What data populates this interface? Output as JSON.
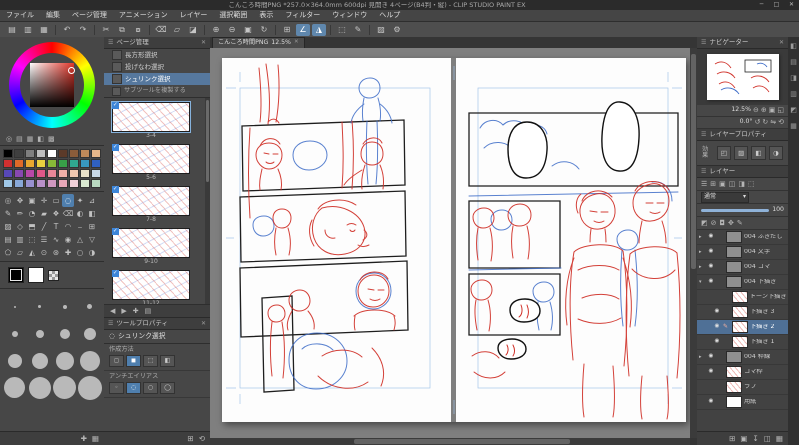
{
  "window": {
    "title": "こんころ時間PNG *257.0×364.0mm 600dpi 見開き 4ページ(B4判・縦) - CLIP STUDIO PAINT EX",
    "controls": {
      "min": "─",
      "max": "□",
      "close": "✕"
    }
  },
  "menubar": {
    "items": [
      "ファイル",
      "編集",
      "ページ管理",
      "アニメーション",
      "レイヤー",
      "選択範囲",
      "表示",
      "フィルター",
      "ウィンドウ",
      "ヘルプ"
    ]
  },
  "toolbar": {
    "icons": [
      {
        "name": "new-file-icon",
        "glyph": "▤"
      },
      {
        "name": "open-file-icon",
        "glyph": "▥"
      },
      {
        "name": "save-icon",
        "glyph": "▦"
      },
      {
        "sep": true
      },
      {
        "name": "undo-icon",
        "glyph": "↶"
      },
      {
        "name": "redo-icon",
        "glyph": "↷"
      },
      {
        "sep": true
      },
      {
        "name": "cut-icon",
        "glyph": "✂"
      },
      {
        "name": "copy-icon",
        "glyph": "⧉"
      },
      {
        "name": "paste-icon",
        "glyph": "⧇"
      },
      {
        "sep": true
      },
      {
        "name": "delete-icon",
        "glyph": "⌫"
      },
      {
        "name": "deselect-icon",
        "glyph": "▱"
      },
      {
        "name": "invert-selection-icon",
        "glyph": "◪"
      },
      {
        "sep": true
      },
      {
        "name": "zoom-in-icon",
        "glyph": "⊕"
      },
      {
        "name": "zoom-out-icon",
        "glyph": "⊖"
      },
      {
        "name": "fit-to-screen-icon",
        "glyph": "▣"
      },
      {
        "name": "rotate-view-icon",
        "glyph": "↻"
      },
      {
        "sep": true
      },
      {
        "name": "snap-grid-icon",
        "glyph": "⊞"
      },
      {
        "name": "snap-ruler-icon",
        "glyph": "∠",
        "active": true
      },
      {
        "name": "snap-special-ruler-icon",
        "glyph": "◮",
        "active": true
      },
      {
        "sep": true
      },
      {
        "name": "selection-tool-icon",
        "glyph": "⬚"
      },
      {
        "name": "pen-tool-icon",
        "glyph": "✎"
      },
      {
        "sep": true
      },
      {
        "name": "material-palette-icon",
        "glyph": "▨"
      },
      {
        "name": "settings-icon",
        "glyph": "⚙"
      }
    ]
  },
  "left_panel": {
    "color_icons": [
      {
        "name": "color-wheel-tab-icon",
        "glyph": "◎"
      },
      {
        "name": "color-slider-tab-icon",
        "glyph": "▤"
      },
      {
        "name": "color-set-tab-icon",
        "glyph": "▦"
      },
      {
        "name": "intermediate-color-tab-icon",
        "glyph": "◧"
      },
      {
        "name": "approximate-color-tab-icon",
        "glyph": "▩"
      }
    ],
    "swatches": [
      "#000000",
      "#3f3f3f",
      "#7f7f7f",
      "#bfbfbf",
      "#ffffff",
      "#5b3a29",
      "#8a5c3a",
      "#c08a5a",
      "#e8b88a",
      "#d03030",
      "#e06a28",
      "#e8a830",
      "#e8d040",
      "#88b838",
      "#38a048",
      "#30a890",
      "#3898c0",
      "#3060c0",
      "#5848b8",
      "#8848b0",
      "#b848a8",
      "#e05888",
      "#e88898",
      "#f0b0a8",
      "#f0c8b0",
      "#e8e0c8",
      "#c8d8e8",
      "#a0c8e8",
      "#88a8d8",
      "#9890d0",
      "#b890c8",
      "#d098c0",
      "#e8a8b8",
      "#f0d0d8",
      "#d8e8d0",
      "#b8d8c0"
    ],
    "tools": [
      {
        "name": "zoom-tool-icon",
        "glyph": "◎"
      },
      {
        "name": "move-tool-icon",
        "glyph": "✥"
      },
      {
        "name": "operation-tool-icon",
        "glyph": "▣"
      },
      {
        "name": "layer-move-tool-icon",
        "glyph": "✛"
      },
      {
        "name": "rect-select-tool-icon",
        "glyph": "▭"
      },
      {
        "name": "lasso-select-tool-icon",
        "glyph": "◌",
        "active": true
      },
      {
        "name": "auto-select-tool-icon",
        "glyph": "✦"
      },
      {
        "name": "eyedropper-tool-icon",
        "glyph": "⊿"
      },
      {
        "name": "pen-tool-icon",
        "glyph": "✎"
      },
      {
        "name": "pencil-tool-icon",
        "glyph": "✏"
      },
      {
        "name": "airbrush-tool-icon",
        "glyph": "◔"
      },
      {
        "name": "brush-tool-icon",
        "glyph": "▰"
      },
      {
        "name": "decoration-tool-icon",
        "glyph": "❖"
      },
      {
        "name": "eraser-tool-icon",
        "glyph": "⌫"
      },
      {
        "name": "blend-tool-icon",
        "glyph": "◐"
      },
      {
        "name": "fill-tool-icon",
        "glyph": "◧"
      },
      {
        "name": "gradient-tool-icon",
        "glyph": "▨"
      },
      {
        "name": "figure-tool-icon",
        "glyph": "◇"
      },
      {
        "name": "frame-border-tool-icon",
        "glyph": "⬒"
      },
      {
        "name": "ruler-tool-icon",
        "glyph": "╱"
      },
      {
        "name": "text-tool-icon",
        "glyph": "T"
      },
      {
        "name": "balloon-tool-icon",
        "glyph": "◠"
      },
      {
        "name": "line-tool-icon",
        "glyph": "⎯"
      },
      {
        "name": "grid-tool-icon",
        "glyph": "⊞"
      },
      {
        "name": "tone-a-tool-icon",
        "glyph": "▤"
      },
      {
        "name": "tone-b-tool-icon",
        "glyph": "▥"
      },
      {
        "name": "pattern-tool-icon",
        "glyph": "⬚"
      },
      {
        "name": "hatch-tool-icon",
        "glyph": "☰"
      },
      {
        "name": "wave-tool-icon",
        "glyph": "∿"
      },
      {
        "name": "curve-tool-icon",
        "glyph": "◉"
      },
      {
        "name": "triangle-tool-icon",
        "glyph": "△"
      },
      {
        "name": "inv-triangle-tool-icon",
        "glyph": "▽"
      },
      {
        "name": "polygon-tool-icon",
        "glyph": "⬠"
      },
      {
        "name": "parallelogram-tool-icon",
        "glyph": "▱"
      },
      {
        "name": "cone-tool-icon",
        "glyph": "◭"
      },
      {
        "name": "dot-tool-icon",
        "glyph": "⊙"
      },
      {
        "name": "spiral-tool-icon",
        "glyph": "⊛"
      },
      {
        "name": "plus-tool-icon",
        "glyph": "✚"
      },
      {
        "name": "circle-sel-tool-icon",
        "glyph": "○"
      },
      {
        "name": "mix-tool-icon",
        "glyph": "◑"
      }
    ],
    "current_colors": {
      "main": "#000000",
      "sub": "#ffffff"
    },
    "brush_sizes": [
      2,
      3,
      4,
      5,
      6,
      8,
      10,
      12,
      14,
      16,
      18,
      20,
      21,
      22,
      23,
      24
    ],
    "footer": {
      "add_icon": "✚",
      "delete_icon": "▦"
    }
  },
  "pages_panel": {
    "header": "ページ管理",
    "subtools": [
      {
        "label": "長方形選択"
      },
      {
        "label": "投げなわ選択"
      },
      {
        "label": "シュリンク選択",
        "selected": true
      }
    ],
    "option_label": "サブツールを複製する",
    "pages": [
      {
        "label": "3-4",
        "badge": "✓",
        "selected": true
      },
      {
        "label": "5-6",
        "badge": "✓"
      },
      {
        "label": "7-8",
        "badge": "✓"
      },
      {
        "label": "9-10",
        "badge": "✓"
      },
      {
        "label": "11-12",
        "badge": "✓"
      }
    ],
    "footer_icons": [
      {
        "name": "prev-page-icon",
        "glyph": "◀"
      },
      {
        "name": "next-page-icon",
        "glyph": "▶"
      },
      {
        "name": "add-page-icon",
        "glyph": "✚"
      },
      {
        "name": "page-list-icon",
        "glyph": "▤"
      }
    ]
  },
  "tool_property": {
    "header": "ツールプロパティ",
    "subtitle": "シュリンク選択",
    "props": [
      {
        "label": "作成方法",
        "icons": [
          "◻",
          "◼",
          "⬚",
          "◧"
        ],
        "active_index": 1
      },
      {
        "label": "アンチエイリアス",
        "icons": [
          "◦",
          "◌",
          "○",
          "◯"
        ],
        "active_index": 2
      }
    ]
  },
  "canvas": {
    "tab_title": "こんころ時間PNG",
    "tab_zoom": "12.5%",
    "tab_close": "✕"
  },
  "navigator": {
    "zoom_icons": [
      {
        "name": "nav-zoom-out-icon",
        "glyph": "⊖"
      },
      {
        "name": "nav-zoom-in-icon",
        "glyph": "⊕"
      },
      {
        "name": "nav-fit-icon",
        "glyph": "▣"
      },
      {
        "name": "nav-actual-size-icon",
        "glyph": "◱"
      }
    ],
    "zoom_value": "12.5%",
    "rotate_icons": [
      {
        "name": "nav-rotate-left-icon",
        "glyph": "↺"
      },
      {
        "name": "nav-rotate-right-icon",
        "glyph": "↻"
      },
      {
        "name": "nav-flip-icon",
        "glyph": "⇋"
      },
      {
        "name": "nav-reset-icon",
        "glyph": "⟲"
      }
    ],
    "rotate_value": "0.0°"
  },
  "layer_property": {
    "header": "レイヤープロパティ",
    "effect_label": "効果",
    "effect_icons": [
      {
        "name": "border-effect-icon",
        "glyph": "◰"
      },
      {
        "name": "tone-effect-icon",
        "glyph": "▨"
      },
      {
        "name": "layer-color-effect-icon",
        "glyph": "◧"
      },
      {
        "name": "expression-color-icon",
        "glyph": "◑"
      }
    ]
  },
  "layer_panel": {
    "header": "レイヤー",
    "palette_icons": [
      {
        "name": "layer-menu-icon",
        "glyph": "☰"
      },
      {
        "name": "new-layer-icon",
        "glyph": "⊞"
      },
      {
        "name": "new-folder-icon",
        "glyph": "▣"
      },
      {
        "name": "combine-icon",
        "glyph": "◫"
      },
      {
        "name": "mask-icon",
        "glyph": "◨"
      },
      {
        "name": "onion-icon",
        "glyph": "⬚"
      }
    ],
    "blend_mode": "通常",
    "blend_caret": "▾",
    "opacity_value": "100",
    "lock_icons": [
      {
        "name": "lock-transparent-icon",
        "glyph": "◩"
      },
      {
        "name": "lock-layer-icon",
        "glyph": "⊘"
      },
      {
        "name": "clip-icon",
        "glyph": "◘"
      },
      {
        "name": "reference-icon",
        "glyph": "✥"
      },
      {
        "name": "draft-icon",
        "glyph": "✎"
      }
    ],
    "layers": [
      {
        "name": "004 ふきだし",
        "is_folder": true,
        "eye": true
      },
      {
        "name": "004 文字",
        "is_folder": true,
        "eye": true
      },
      {
        "name": "004 コマ",
        "is_folder": true,
        "eye": true
      },
      {
        "name": "004 下描き",
        "is_folder": true,
        "open": true,
        "eye": true
      },
      {
        "name": "トーン下描き",
        "indent": 1,
        "eye": false
      },
      {
        "name": "下描き 3",
        "indent": 1,
        "eye": true
      },
      {
        "name": "下描き 2",
        "indent": 1,
        "eye": true,
        "selected": true,
        "pen": true
      },
      {
        "name": "下描き 1",
        "indent": 1,
        "eye": true
      },
      {
        "name": "004 枠線",
        "is_folder": true,
        "eye": true
      },
      {
        "name": "コマ枠",
        "eye": true
      },
      {
        "name": "ラフ",
        "eye": false
      },
      {
        "name": "用紙",
        "is_paper": true,
        "eye": true
      }
    ],
    "footer_icons": [
      {
        "name": "new-layer-button",
        "glyph": "⊞"
      },
      {
        "name": "new-folder-button",
        "glyph": "▣"
      },
      {
        "name": "transfer-button",
        "glyph": "↧"
      },
      {
        "name": "merge-button",
        "glyph": "◫"
      },
      {
        "name": "delete-layer-button",
        "glyph": "▦"
      }
    ]
  },
  "edge_strip": {
    "tabs": [
      {
        "name": "material-tab-1-icon",
        "glyph": "◧"
      },
      {
        "name": "material-tab-2-icon",
        "glyph": "▤"
      },
      {
        "name": "material-tab-3-icon",
        "glyph": "◨"
      },
      {
        "name": "material-tab-4-icon",
        "glyph": "▥"
      },
      {
        "name": "material-tab-5-icon",
        "glyph": "◩"
      },
      {
        "name": "material-tab-6-icon",
        "glyph": "▦"
      }
    ]
  },
  "colors": {
    "accent": "#5f87ad",
    "selected_row": "#4f7096",
    "sketch_red": "#d03028",
    "sketch_blue": "#3d6cc8",
    "canvas_bg": "#7f7f7f",
    "panel_bg": "#474747"
  }
}
